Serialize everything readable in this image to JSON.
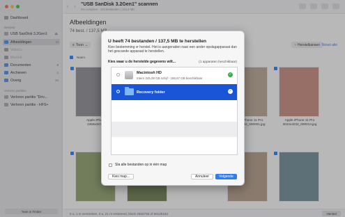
{
  "sidebar": {
    "top_item": {
      "label": "Dashboard"
    },
    "section_disk": "Bestand",
    "disk": {
      "label": "USB  SanDisk 3.2Gen1"
    },
    "items": [
      {
        "label": "Afbeeldingen",
        "badge": "74"
      },
      {
        "label": "Video's",
        "badge": ""
      },
      {
        "label": "Muziek",
        "badge": ""
      },
      {
        "label": "Documenten",
        "badge": "8"
      },
      {
        "label": "Archieven",
        "badge": "2"
      },
      {
        "label": "Overig",
        "badge": "64"
      }
    ],
    "section_lost": "Verloren partities",
    "lost": [
      {
        "label": "Verloren partitie \"Driv..."
      },
      {
        "label": "Verloren partitie - HFS+"
      }
    ],
    "finder_button": "Toon in Finder"
  },
  "toolbar": {
    "nav": "‹ ›",
    "title": "\"USB  SanDisk 3.2Gen1\" scannen",
    "subtitle": "8% compleet · 183 bestanden | 154,4 MB"
  },
  "main": {
    "heading": "Afbeeldingen",
    "subheading": "74 best. / 137,5 MB",
    "filter_label": "Toon",
    "restore_label": "Herstelkansen",
    "select_all": "Reset alle",
    "column_name": "Naam"
  },
  "tiles": [
    {
      "caption": "Apple iPhone\n2459x3279_",
      "color": "#8d8d92",
      "checked": true
    },
    {
      "caption": "",
      "color": "#7a8fa6",
      "checked": true
    },
    {
      "caption": "",
      "color": "#c9b89a",
      "checked": true
    },
    {
      "caption": "Apple iPhone 11 Pro\n3024x4032_000001.jpg",
      "color": "#b7a691",
      "checked": true
    },
    {
      "caption": "Apple iPhone 11 Pro\n3024x4032_000014.jpg",
      "color": "#c98a7c",
      "checked": true
    },
    {
      "caption": "",
      "color": "#8ea06b",
      "checked": true
    },
    {
      "caption": "",
      "color": "#6c7c4d",
      "checked": true
    },
    {
      "caption": "",
      "color": "#a59481",
      "checked": true
    },
    {
      "caption": "",
      "color": "#b39b86",
      "checked": true
    },
    {
      "caption": "",
      "color": "#6f8a96",
      "checked": true
    }
  ],
  "status": {
    "text": "0 u, 1 m verstreken, 0 u, 21 m resterend, block 2932736 of 60125184",
    "herstel_button": "Herstel"
  },
  "dialog": {
    "title": "U heeft 74 bestanden / 137,5 MB te herstellen",
    "description": "Kies bestemming vr herstel. Het is aangeraden naar een ander opslagapparaat dan het gescande apparaat te herstellen.",
    "list_label": "Kies waar u de herstelde gegevens wilt...",
    "available": "(1 apparaten beschikbaar)",
    "destinations": [
      {
        "name": "Macintosh HD",
        "info": "Intern 245,08 GB schijf - 186,67 GB beschikbaar",
        "selected": false
      },
      {
        "name": "Recovery folder",
        "info": "",
        "selected": true
      }
    ],
    "skip_label": "Sla alle bestanden op in één map",
    "choose_map": "Kies map...",
    "cancel": "Annuleer",
    "next": "Volgende"
  }
}
